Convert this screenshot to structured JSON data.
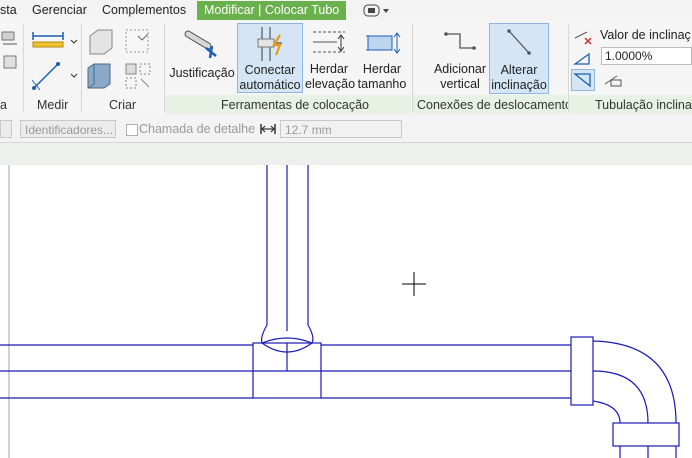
{
  "menu": {
    "tabs": [
      {
        "label": "sta"
      },
      {
        "label": "Gerenciar"
      },
      {
        "label": "Complementos"
      },
      {
        "label": "Modificar | Colocar Tubo"
      }
    ]
  },
  "ribbon": {
    "panels": {
      "measure": "Medir",
      "create": "Criar",
      "placement": "Ferramentas de colocação",
      "offset": "Conexões de deslocamento",
      "slope": "Tubulação inclinad",
      "left_cut": "a"
    },
    "buttons": {
      "justify": "Justificação",
      "autoconnect_1": "Conectar",
      "autoconnect_2": "automático",
      "inherit_elev_1": "Herdar",
      "inherit_elev_2": "elevação",
      "inherit_size_1": "Herdar",
      "inherit_size_2": "tamanho",
      "add_vertical_1": "Adicionar",
      "add_vertical_2": "vertical",
      "change_slope_1": "Alterar",
      "change_slope_2": "inclinação"
    },
    "slope_value_label": "Valor de inclinaç",
    "slope_value": "1.0000%"
  },
  "options": {
    "identifiers_placeholder": "Identificadores...",
    "detail_callout": "Chamada de detalhe",
    "dimension_value": "12.7 mm"
  },
  "colors": {
    "active_tab": "#6ab04c",
    "pipe_line": "#1a1ab4",
    "selected_button": "#d4e6f5"
  }
}
